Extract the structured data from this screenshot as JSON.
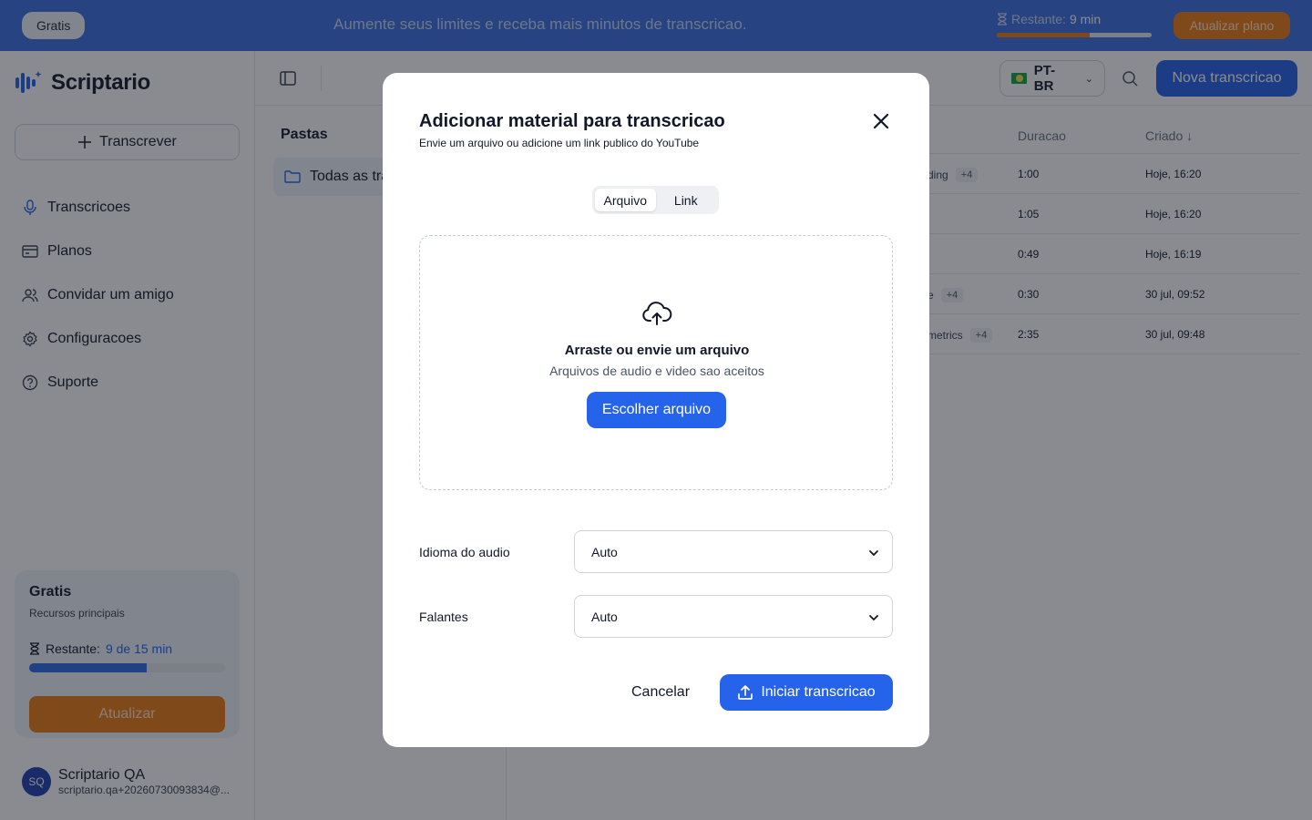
{
  "banner": {
    "plan_pill": "Gratis",
    "message": "Aumente seus limites e receba mais minutos de transcricao.",
    "remaining_label": "Restante:",
    "remaining_value": "9 min",
    "remaining_fraction": 0.6,
    "upgrade_label": "Atualizar plano"
  },
  "sidebar": {
    "app_name": "Scriptario",
    "transcribe_label": "Transcrever",
    "items": [
      {
        "label": "Transcricoes",
        "icon": "mic-icon"
      },
      {
        "label": "Planos",
        "icon": "billing-icon"
      },
      {
        "label": "Convidar um amigo",
        "icon": "users-icon"
      },
      {
        "label": "Configuracoes",
        "icon": "gear-icon"
      },
      {
        "label": "Suporte",
        "icon": "help-icon"
      }
    ],
    "plan_card": {
      "title": "Gratis",
      "subtitle": "Recursos principais",
      "remaining_label": "Restante:",
      "remaining_value": "9 de 15 min",
      "remaining_fraction": 0.6,
      "upgrade_label": "Atualizar"
    },
    "user": {
      "initials": "SQ",
      "name": "Scriptario QA",
      "email": "scriptario.qa+20260730093834@..."
    }
  },
  "toolbar": {
    "language": "PT-BR",
    "new_label": "Nova transcricao"
  },
  "folders": {
    "heading": "Pastas",
    "all_label": "Todas as tra"
  },
  "table": {
    "col_duration": "Duracao",
    "col_created": "Criado ↓",
    "rows": [
      {
        "frag": "ding",
        "tag": "+4",
        "duration": "1:00",
        "created": "Hoje, 16:20"
      },
      {
        "frag": "",
        "tag": "",
        "duration": "1:05",
        "created": "Hoje, 16:20"
      },
      {
        "frag": "",
        "tag": "",
        "duration": "0:49",
        "created": "Hoje, 16:19"
      },
      {
        "frag": "e",
        "tag": "+4",
        "duration": "0:30",
        "created": "30 jul, 09:52"
      },
      {
        "frag": "metrics",
        "tag": "+4",
        "duration": "2:35",
        "created": "30 jul, 09:48"
      }
    ]
  },
  "modal": {
    "title": "Adicionar material para transcricao",
    "subtitle": "Envie um arquivo ou adicione um link publico do YouTube",
    "tab_file": "Arquivo",
    "tab_link": "Link",
    "drop_title": "Arraste ou envie um arquivo",
    "drop_subtitle": "Arquivos de audio e video sao aceitos",
    "choose_label": "Escolher arquivo",
    "language_label": "Idioma do audio",
    "language_value": "Auto",
    "speakers_label": "Falantes",
    "speakers_value": "Auto",
    "cancel_label": "Cancelar",
    "start_label": "Iniciar transcricao"
  },
  "colors": {
    "banner": "#3b6fe0",
    "accent": "#2563eb",
    "orange": "#ea7a12"
  }
}
